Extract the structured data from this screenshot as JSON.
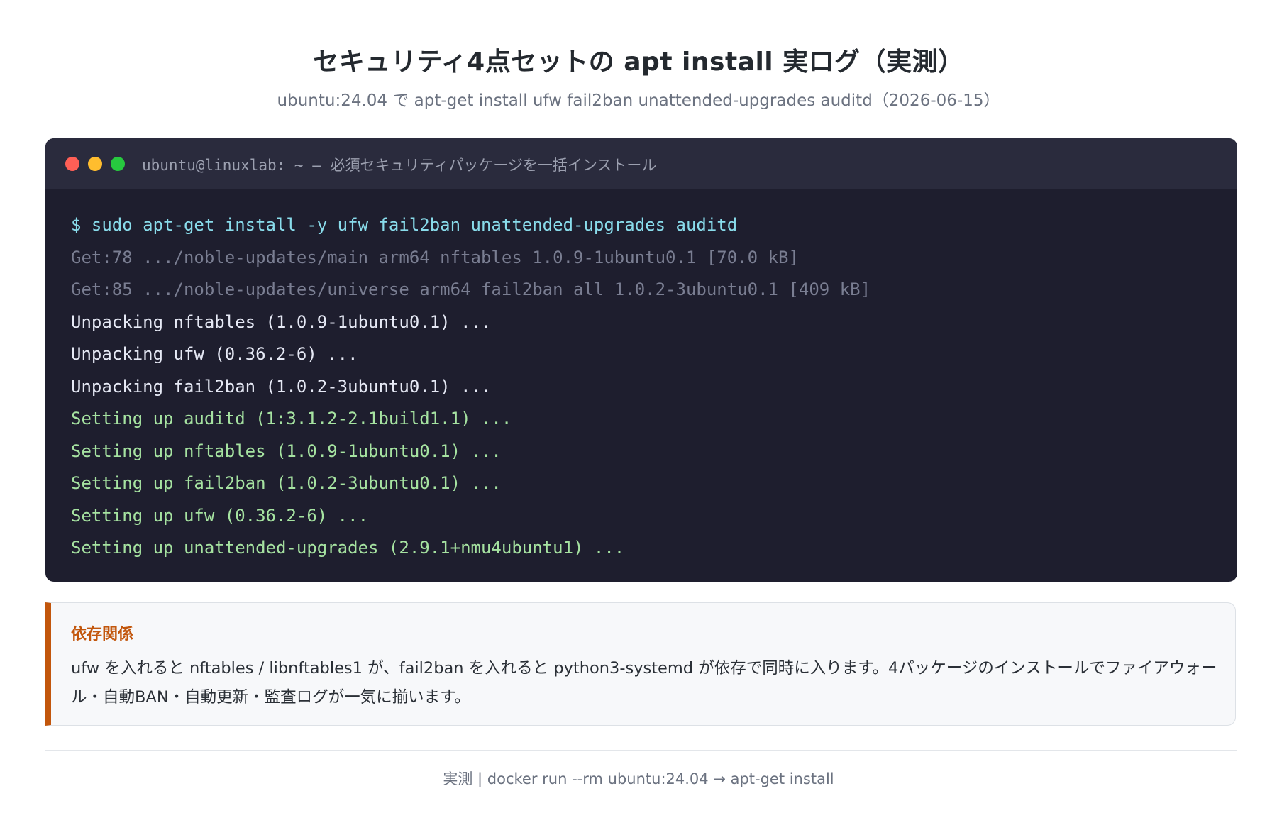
{
  "header": {
    "title": "セキュリティ4点セットの apt install 実ログ（実測）",
    "subtitle": "ubuntu:24.04 で apt-get install ufw fail2ban unattended-upgrades auditd（2026-06-15）"
  },
  "terminal": {
    "window_title": "ubuntu@linuxlab: ~ — 必須セキュリティパッケージを一括インストール",
    "lines": [
      {
        "kind": "cmd",
        "text": "$ sudo apt-get install -y ufw fail2ban unattended-upgrades auditd"
      },
      {
        "kind": "dim",
        "text": "Get:78 .../noble-updates/main arm64 nftables 1.0.9-1ubuntu0.1 [70.0 kB]"
      },
      {
        "kind": "dim",
        "text": "Get:85 .../noble-updates/universe arm64 fail2ban all 1.0.2-3ubuntu0.1 [409 kB]"
      },
      {
        "kind": "plain",
        "text": "Unpacking nftables (1.0.9-1ubuntu0.1) ..."
      },
      {
        "kind": "plain",
        "text": "Unpacking ufw (0.36.2-6) ..."
      },
      {
        "kind": "plain",
        "text": "Unpacking fail2ban (1.0.2-3ubuntu0.1) ..."
      },
      {
        "kind": "ok",
        "text": "Setting up auditd (1:3.1.2-2.1build1.1) ..."
      },
      {
        "kind": "ok",
        "text": "Setting up nftables (1.0.9-1ubuntu0.1) ..."
      },
      {
        "kind": "ok",
        "text": "Setting up fail2ban (1.0.2-3ubuntu0.1) ..."
      },
      {
        "kind": "ok",
        "text": "Setting up ufw (0.36.2-6) ..."
      },
      {
        "kind": "ok",
        "text": "Setting up unattended-upgrades (2.9.1+nmu4ubuntu1) ..."
      }
    ]
  },
  "note": {
    "title": "依存関係",
    "text": "ufw を入れると nftables / libnftables1 が、fail2ban を入れると python3-systemd が依存で同時に入ります。4パッケージのインストールでファイアウォール・自動BAN・自動更新・監査ログが一気に揃います。"
  },
  "footer": {
    "text": "実測 | docker run --rm ubuntu:24.04 → apt-get install"
  },
  "colors": {
    "terminal_bg": "#1e1e2e",
    "terminal_bar": "#2a2b3d",
    "command": "#89dceb",
    "dim_output": "#7a7e92",
    "plain_output": "#e6e9f5",
    "success_output": "#a6e3a1",
    "note_accent": "#c2560c"
  }
}
